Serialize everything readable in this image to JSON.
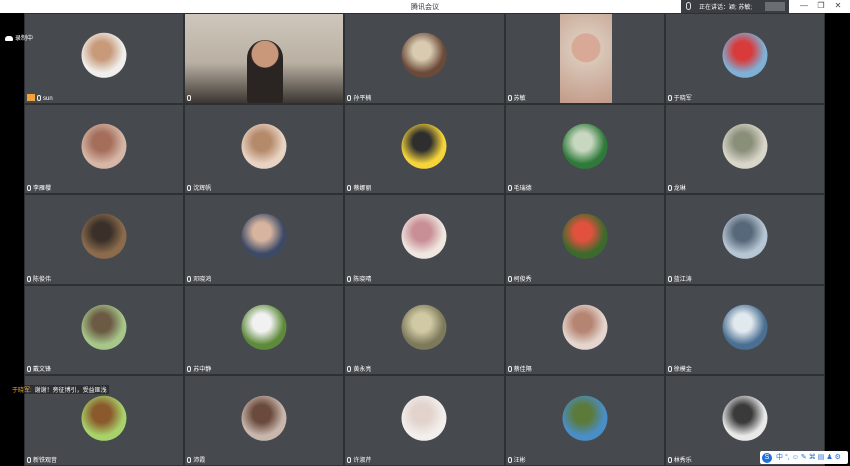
{
  "window": {
    "title": "腾讯会议",
    "minimize_icon": "—",
    "restore_icon": "❐",
    "close_icon": "✕"
  },
  "speaking": {
    "label": "正在讲话：",
    "speaker": "颖; 苏敏;"
  },
  "recording": {
    "label": "录制中"
  },
  "chat": {
    "sender": "于晓军:",
    "message": "谢谢！旁征博引，受益匪浅"
  },
  "tiles": [
    {
      "name": "sun",
      "icon": "cartoon-couple-avatar",
      "colors": [
        "#f0efec",
        "#c89a7a"
      ],
      "host": true
    },
    {
      "name": "",
      "icon": "video-feed",
      "colors": [
        "#cfc7bb",
        "#3b3632"
      ],
      "video": true
    },
    {
      "name": "孙平楠",
      "icon": "colorful-photo-avatar",
      "colors": [
        "#6c4a3a",
        "#d8cbb0"
      ]
    },
    {
      "name": "苏敏",
      "icon": "video-feed",
      "colors": [
        "#d9c7b8",
        "#c39a88"
      ],
      "video": true
    },
    {
      "name": "于晓军",
      "icon": "red-cap-avatar",
      "colors": [
        "#7fb0d6",
        "#d93a3a"
      ]
    },
    {
      "name": "李雁櫻",
      "icon": "child-photo-avatar",
      "colors": [
        "#d6b6a6",
        "#a46e5b"
      ]
    },
    {
      "name": "沈辉帆",
      "icon": "hand-avatar",
      "colors": [
        "#e9d4c3",
        "#b58a6b"
      ]
    },
    {
      "name": "蔡娜丽",
      "icon": "pikachu-avatar",
      "colors": [
        "#f6d53a",
        "#2e2e2e"
      ]
    },
    {
      "name": "毛瑞德",
      "icon": "landscape-avatar",
      "colors": [
        "#2f7a3a",
        "#c8d8c0"
      ]
    },
    {
      "name": "龙琳",
      "icon": "path-avatar",
      "colors": [
        "#d9d6c9",
        "#8a8f7a"
      ]
    },
    {
      "name": "陈俊伟",
      "icon": "chalkboard-avatar",
      "colors": [
        "#8b6b4c",
        "#3a3029"
      ]
    },
    {
      "name": "邓晓鸿",
      "icon": "portrait-avatar",
      "colors": [
        "#3c4a66",
        "#d6b4a0"
      ]
    },
    {
      "name": "陈晓晴",
      "icon": "family-photo-avatar",
      "colors": [
        "#efe7e0",
        "#c98f96"
      ]
    },
    {
      "name": "柯俊秀",
      "icon": "flower-avatar",
      "colors": [
        "#3c6a2c",
        "#e0523e"
      ]
    },
    {
      "name": "蓝江涛",
      "icon": "skyline-avatar",
      "colors": [
        "#b7c6d4",
        "#57687a"
      ]
    },
    {
      "name": "戴文锋",
      "icon": "cyclist-avatar",
      "colors": [
        "#a7c78a",
        "#6b5a44"
      ]
    },
    {
      "name": "苏中静",
      "icon": "rabbit-avatar",
      "colors": [
        "#5e8a3b",
        "#f1f1f1"
      ]
    },
    {
      "name": "黄永亮",
      "icon": "statue-avatar",
      "colors": [
        "#7c7a5a",
        "#d1c9a4"
      ]
    },
    {
      "name": "蔡佳隔",
      "icon": "room-avatar",
      "colors": [
        "#e4d6cf",
        "#b68472"
      ]
    },
    {
      "name": "徐模金",
      "icon": "lake-avatar",
      "colors": [
        "#4a6f92",
        "#e1e8ee"
      ]
    },
    {
      "name": "新铁观音",
      "icon": "cowboy-cartoon-avatar",
      "colors": [
        "#a8d26a",
        "#8a5a2c"
      ]
    },
    {
      "name": "沛霞",
      "icon": "phone-photo-avatar",
      "colors": [
        "#c9b7ae",
        "#6a4a3c"
      ]
    },
    {
      "name": "许淑芹",
      "icon": "heart-hands-avatar",
      "colors": [
        "#f3efec",
        "#e2d3cc"
      ]
    },
    {
      "name": "汪彬",
      "icon": "mountain-sea-avatar",
      "colors": [
        "#4a8ec7",
        "#5c7a3a"
      ]
    },
    {
      "name": "林秀乐",
      "icon": "patton-text-avatar",
      "colors": [
        "#e9e9e9",
        "#3a3a3a"
      ]
    }
  ],
  "ime": {
    "logo": "S",
    "items": [
      "中",
      "°,",
      "☺",
      "✎",
      "⌘",
      "▤",
      "♟",
      "⚙"
    ]
  }
}
